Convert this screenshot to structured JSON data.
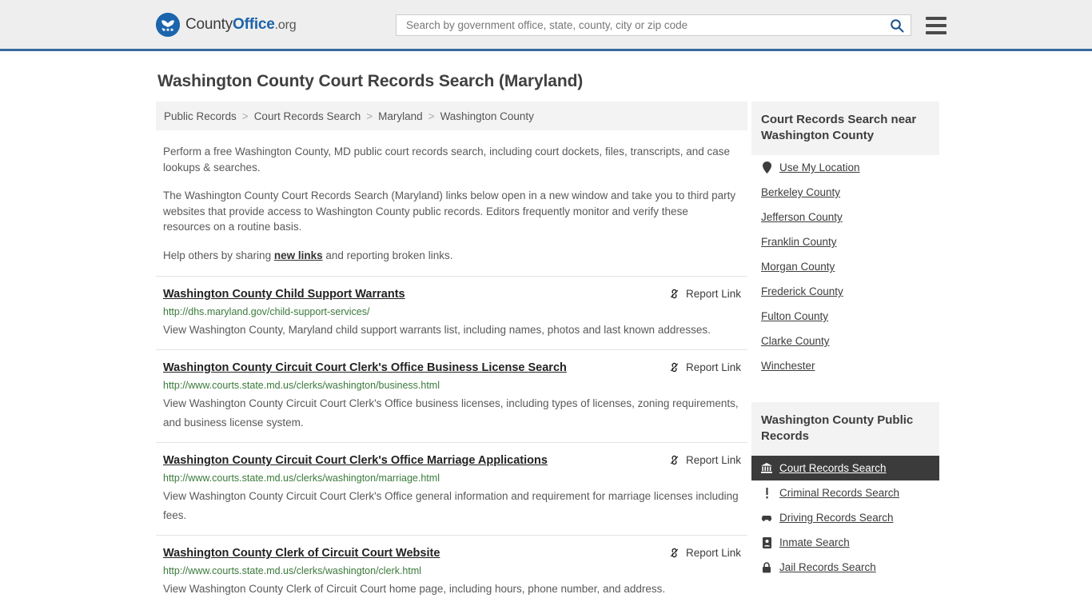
{
  "header": {
    "logo": {
      "icon": "eagle-shield-logo",
      "text_county": "County",
      "text_office": "Office",
      "text_org": ".org"
    },
    "search": {
      "placeholder": "Search by government office, state, county, city or zip code",
      "value": "",
      "search_icon": "search-icon"
    },
    "menu_icon": "hamburger-menu-icon",
    "accent_color": "#36699c",
    "background_color": "#eeeeee"
  },
  "page": {
    "title": "Washington County Court Records Search (Maryland)"
  },
  "breadcrumb": {
    "separator": ">",
    "items": [
      {
        "label": "Public Records"
      },
      {
        "label": "Court Records Search"
      },
      {
        "label": "Maryland"
      },
      {
        "label": "Washington County"
      }
    ]
  },
  "intro": {
    "paragraph_1": "Perform a free Washington County, MD public court records search, including court dockets, files, transcripts, and case lookups & searches.",
    "paragraph_2": "The Washington County Court Records Search (Maryland) links below open in a new window and take you to third party websites that provide access to Washington County public records. Editors frequently monitor and verify these resources on a routine basis.",
    "paragraph_3_before": "Help others by sharing ",
    "paragraph_3_link": "new links",
    "paragraph_3_after": " and reporting broken links."
  },
  "report_link_label": "Report Link",
  "report_link_icon": "broken-link-icon",
  "results": [
    {
      "title": "Washington County Child Support Warrants",
      "url": "http://dhs.maryland.gov/child-support-services/",
      "description": "View Washington County, Maryland child support warrants list, including names, photos and last known addresses.",
      "report_label": "Report Link"
    },
    {
      "title": "Washington County Circuit Court Clerk's Office Business License Search",
      "url": "http://www.courts.state.md.us/clerks/washington/business.html",
      "description": "View Washington County Circuit Court Clerk's Office business licenses, including types of licenses, zoning requirements, and business license system.",
      "report_label": "Report Link"
    },
    {
      "title": "Washington County Circuit Court Clerk's Office Marriage Applications",
      "url": "http://www.courts.state.md.us/clerks/washington/marriage.html",
      "description": "View Washington County Circuit Court Clerk's Office general information and requirement for marriage licenses including fees.",
      "report_label": "Report Link"
    },
    {
      "title": "Washington County Clerk of Circuit Court Website",
      "url": "http://www.courts.state.md.us/clerks/washington/clerk.html",
      "description": "View Washington County Clerk of Circuit Court home page, including hours, phone number, and address.",
      "report_label": "Report Link"
    }
  ],
  "sidebar": {
    "nearby": {
      "heading": "Court Records Search near Washington County",
      "items": [
        {
          "label": "Use My Location",
          "icon": "map-pin-icon"
        },
        {
          "label": "Berkeley County",
          "icon": ""
        },
        {
          "label": "Jefferson County",
          "icon": ""
        },
        {
          "label": "Franklin County",
          "icon": ""
        },
        {
          "label": "Morgan County",
          "icon": ""
        },
        {
          "label": "Frederick County",
          "icon": ""
        },
        {
          "label": "Fulton County",
          "icon": ""
        },
        {
          "label": "Clarke County",
          "icon": ""
        },
        {
          "label": "Winchester",
          "icon": ""
        }
      ]
    },
    "public_records": {
      "heading": "Washington County Public Records",
      "items": [
        {
          "label": "Court Records Search",
          "icon": "courthouse-icon",
          "active": true
        },
        {
          "label": "Criminal Records Search",
          "icon": "exclamation-icon",
          "active": false
        },
        {
          "label": "Driving Records Search",
          "icon": "car-icon",
          "active": false
        },
        {
          "label": "Inmate Search",
          "icon": "id-badge-icon",
          "active": false
        },
        {
          "label": "Jail Records Search",
          "icon": "lock-icon",
          "active": false
        }
      ]
    }
  }
}
